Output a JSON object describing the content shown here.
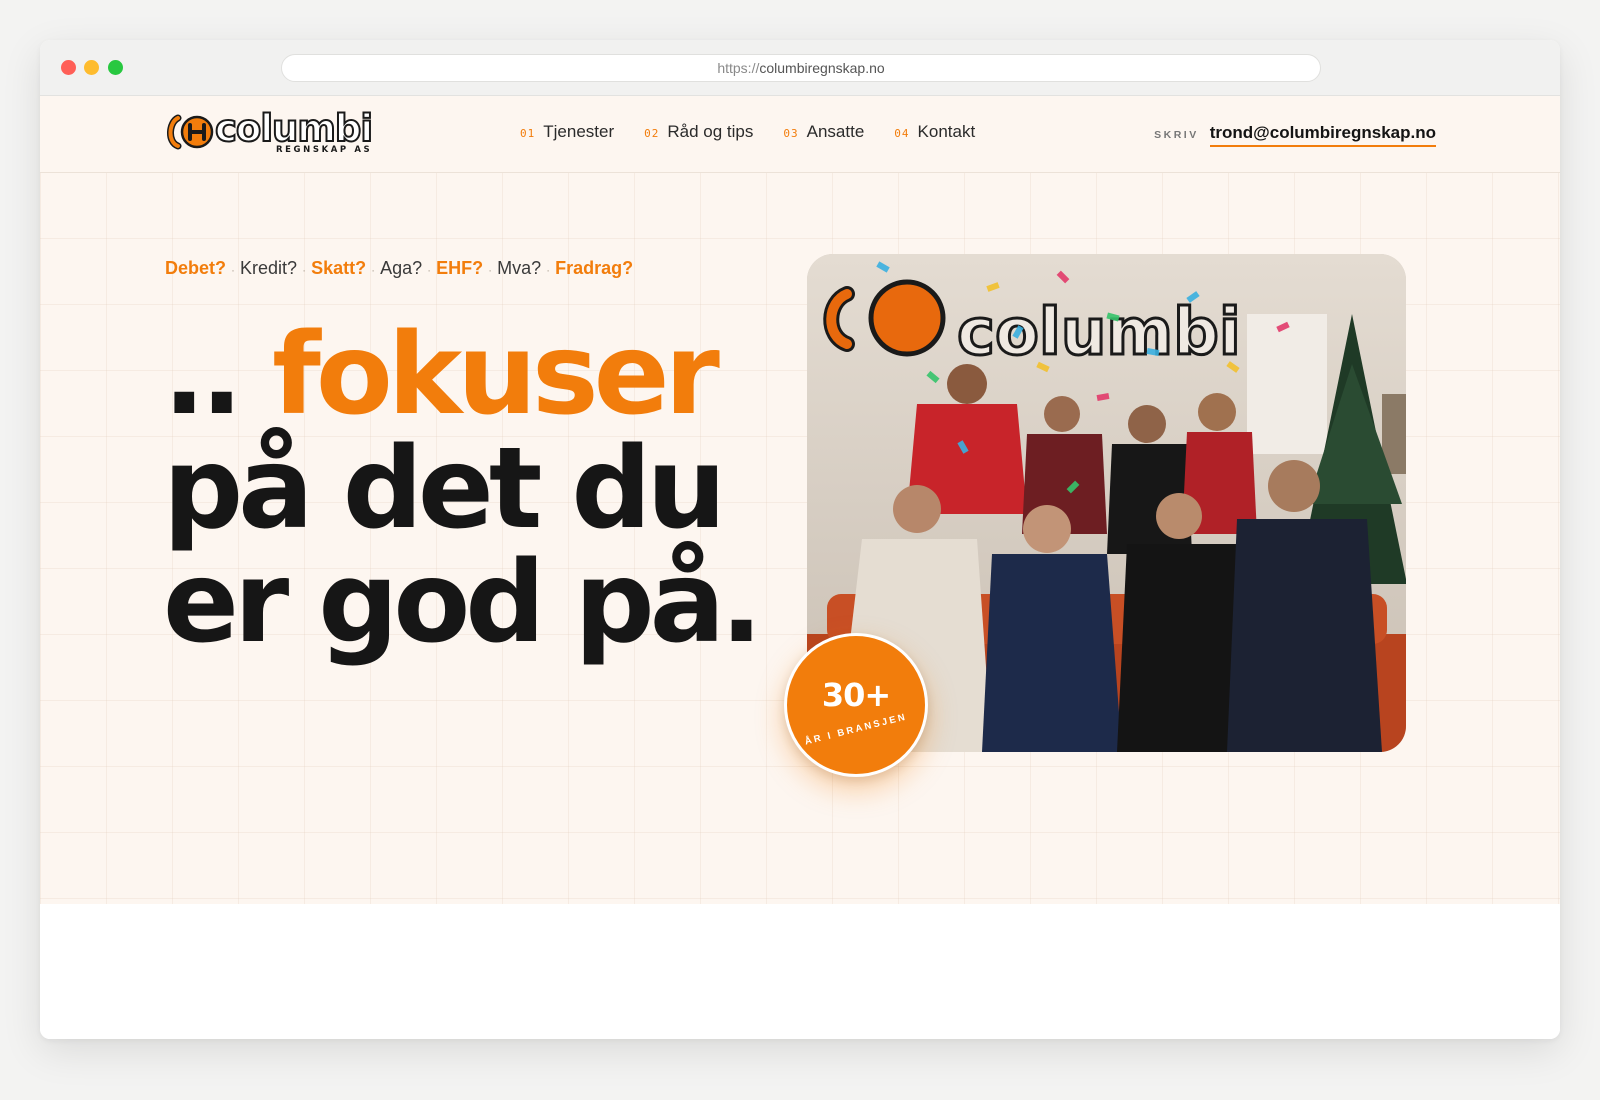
{
  "browser": {
    "url_protocol": "https://",
    "url_host": "columbiregnskap.no"
  },
  "header": {
    "logo": {
      "name": "columbi",
      "subtitle": "REGNSKAP AS"
    },
    "nav": [
      {
        "num": "01",
        "label": "Tjenester"
      },
      {
        "num": "02",
        "label": "Råd og tips"
      },
      {
        "num": "03",
        "label": "Ansatte"
      },
      {
        "num": "04",
        "label": "Kontakt"
      }
    ],
    "contact_label": "SKRIV",
    "contact_email": "trond@columbiregnskap.no"
  },
  "hero": {
    "tags": [
      {
        "text": "Debet?",
        "highlight": true
      },
      {
        "text": "Kredit?",
        "highlight": false
      },
      {
        "text": "Skatt?",
        "highlight": true
      },
      {
        "text": "Aga?",
        "highlight": false
      },
      {
        "text": "EHF?",
        "highlight": true
      },
      {
        "text": "Mva?",
        "highlight": false
      },
      {
        "text": "Fradrag?",
        "highlight": true
      }
    ],
    "tag_separator": "·",
    "headline": {
      "prefix": "..",
      "accent": "fokuser",
      "line2": "på det du",
      "line3": "er god på."
    },
    "photo_icon": "team-photo-image",
    "badge": {
      "number": "30+",
      "text": "ÅR I BRANSJEN"
    }
  },
  "colors": {
    "accent": "#f27d0c",
    "text": "#161616",
    "background": "#fdf6f0"
  }
}
